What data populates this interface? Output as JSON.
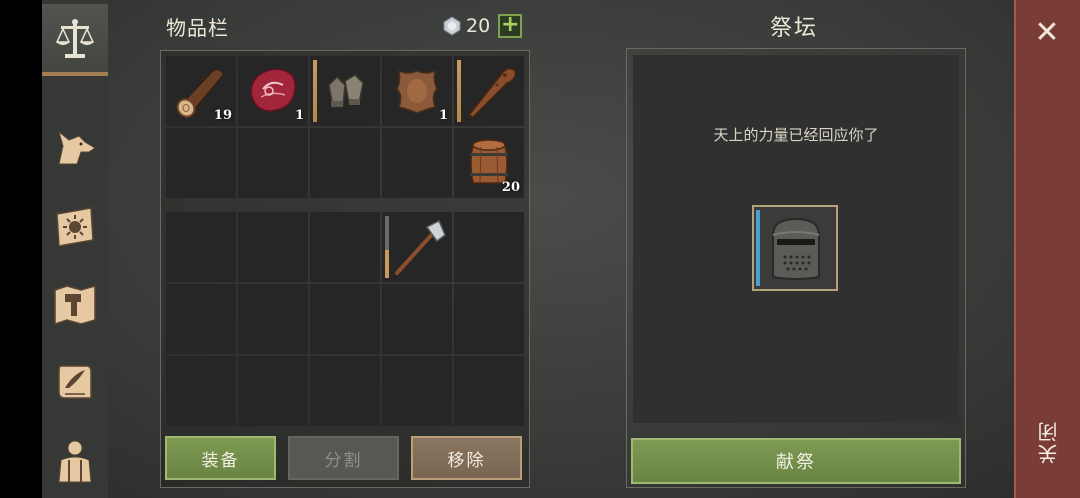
{
  "inventory": {
    "title": "物品栏",
    "gem_count": "20",
    "plus_label": "+",
    "slots": [
      {
        "item": "log-icon",
        "qty": "19"
      },
      {
        "item": "raw-meat-icon",
        "qty": "1"
      },
      {
        "item": "gloves-icon",
        "qty": ""
      },
      {
        "item": "leather-hide-icon",
        "qty": "1"
      },
      {
        "item": "wooden-club-icon",
        "qty": ""
      },
      {
        "item": "barrel-icon",
        "qty": "20"
      },
      {
        "item": "hatchet-icon",
        "qty": ""
      }
    ]
  },
  "buttons": {
    "equip": "装备",
    "split": "分割",
    "remove": "移除"
  },
  "altar": {
    "title": "祭坛",
    "message": "天上的力量已经回应你了",
    "item": "knight-helmet-icon",
    "sacrifice": "献祭"
  },
  "close": {
    "label": "关闭",
    "x": "✕"
  },
  "colors": {
    "accent_green": "#7e9a52",
    "close_red": "#7a3d36",
    "durability": "#c99a5c",
    "altar_slot_bar": "#4aa0d0"
  }
}
